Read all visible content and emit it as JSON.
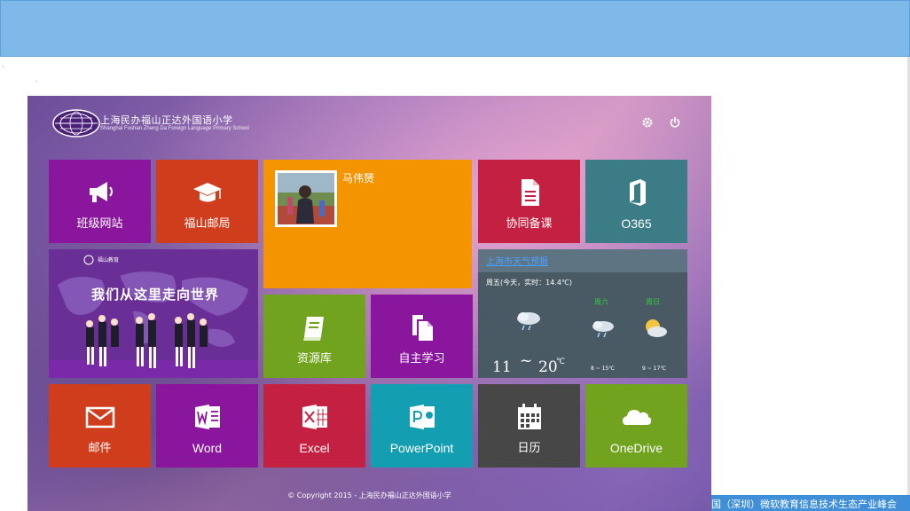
{
  "browser": {
    "ticker_text": "国（深圳）微软教育信息技术生态产业峰会"
  },
  "portal": {
    "school_name_cn": "上海民办福山正达外国语小学",
    "school_name_en": "Shanghai Fushan Zheng Da Foreign Language Primary School",
    "header_icons": [
      "gear-icon",
      "power-icon"
    ],
    "footer": "© Copyright 2015 - 上海民办福山正达外国语小学"
  },
  "tiles": {
    "class_site": "班级网站",
    "mail_office": "福山邮局",
    "user_name": "马伟赟",
    "co_prep": "协同备课",
    "o365": "O365",
    "banner_text": "我们从这里走向世界",
    "banner_logo_text": "福山教育",
    "resources": "资源库",
    "self_study": "自主学习",
    "mail": "邮件",
    "word": "Word",
    "excel": "Excel",
    "powerpoint": "PowerPoint",
    "calendar": "日历",
    "onedrive": "OneDrive"
  },
  "weather": {
    "link": "上海市天气预报",
    "today_line": "周五(今天，实时：14.4℃)",
    "today_low": "11",
    "today_tilde": "~",
    "today_high": "20",
    "today_unit": "℃",
    "day2_label": "周六",
    "day2_range": "8 ~ 15℃",
    "day3_label": "周日",
    "day3_range": "9 ~ 17℃"
  },
  "colors": {
    "purple": "#8b169e",
    "orange_red": "#cf3d1d",
    "orange": "#f39400",
    "crimson": "#c42041",
    "teal": "#3b7c86",
    "green": "#72a31f",
    "cyan": "#139fb1",
    "dark_gray": "#474747",
    "weather_bg": "#4a5a64"
  }
}
